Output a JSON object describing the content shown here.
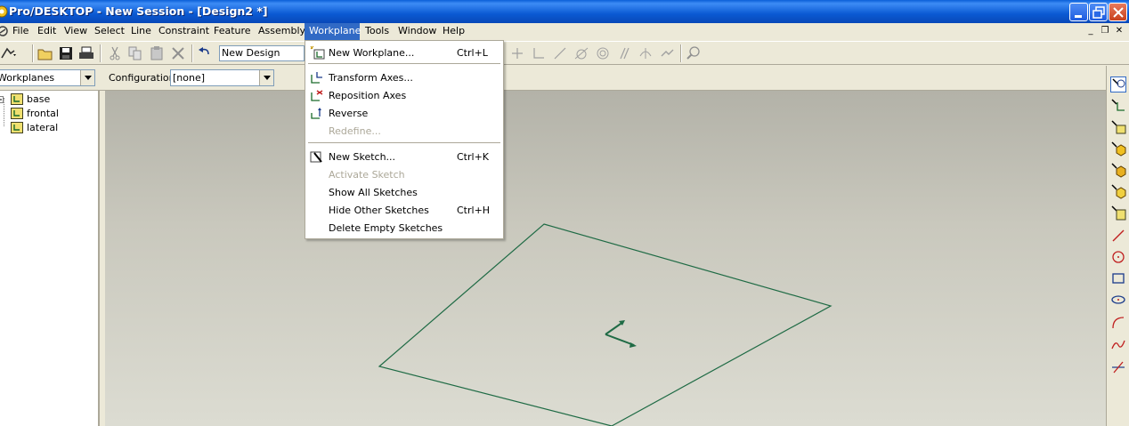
{
  "window": {
    "title": "Pro/DESKTOP - New Session - [Design2 *]"
  },
  "menubar": {
    "items": [
      "File",
      "Edit",
      "View",
      "Select",
      "Line",
      "Constraint",
      "Feature",
      "Assembly",
      "Workplane",
      "Tools",
      "Window",
      "Help"
    ],
    "active": "Workplane"
  },
  "toolbar": {
    "design_name": "New Design"
  },
  "panel": {
    "selector_value": "Workplanes",
    "configuration_label": "Configuration:",
    "configuration_value": "[none]",
    "tree_items": [
      "base",
      "frontal",
      "lateral"
    ]
  },
  "workplane_menu": {
    "items": [
      {
        "label": "New Workplane...",
        "shortcut": "Ctrl+L",
        "icon": "new-workplane-icon",
        "enabled": true
      },
      {
        "label": "Transform Axes...",
        "shortcut": "",
        "icon": "transform-axes-icon",
        "enabled": true
      },
      {
        "label": "Reposition Axes",
        "shortcut": "",
        "icon": "reposition-axes-icon",
        "enabled": true
      },
      {
        "label": "Reverse",
        "shortcut": "",
        "icon": "reverse-icon",
        "enabled": true
      },
      {
        "label": "Redefine...",
        "shortcut": "",
        "icon": "",
        "enabled": false
      },
      {
        "label": "New Sketch...",
        "shortcut": "Ctrl+K",
        "icon": "new-sketch-icon",
        "enabled": true
      },
      {
        "label": "Activate Sketch",
        "shortcut": "",
        "icon": "",
        "enabled": false
      },
      {
        "label": "Show All Sketches",
        "shortcut": "",
        "icon": "",
        "enabled": true
      },
      {
        "label": "Hide Other Sketches",
        "shortcut": "Ctrl+H",
        "icon": "",
        "enabled": true
      },
      {
        "label": "Delete Empty Sketches",
        "shortcut": "",
        "icon": "",
        "enabled": true
      }
    ]
  },
  "colors": {
    "titlebar": "#0b5ad3",
    "menu_highlight": "#316ac5",
    "workplane_outline": "#1f6b45",
    "disabled_text": "#aca899"
  }
}
